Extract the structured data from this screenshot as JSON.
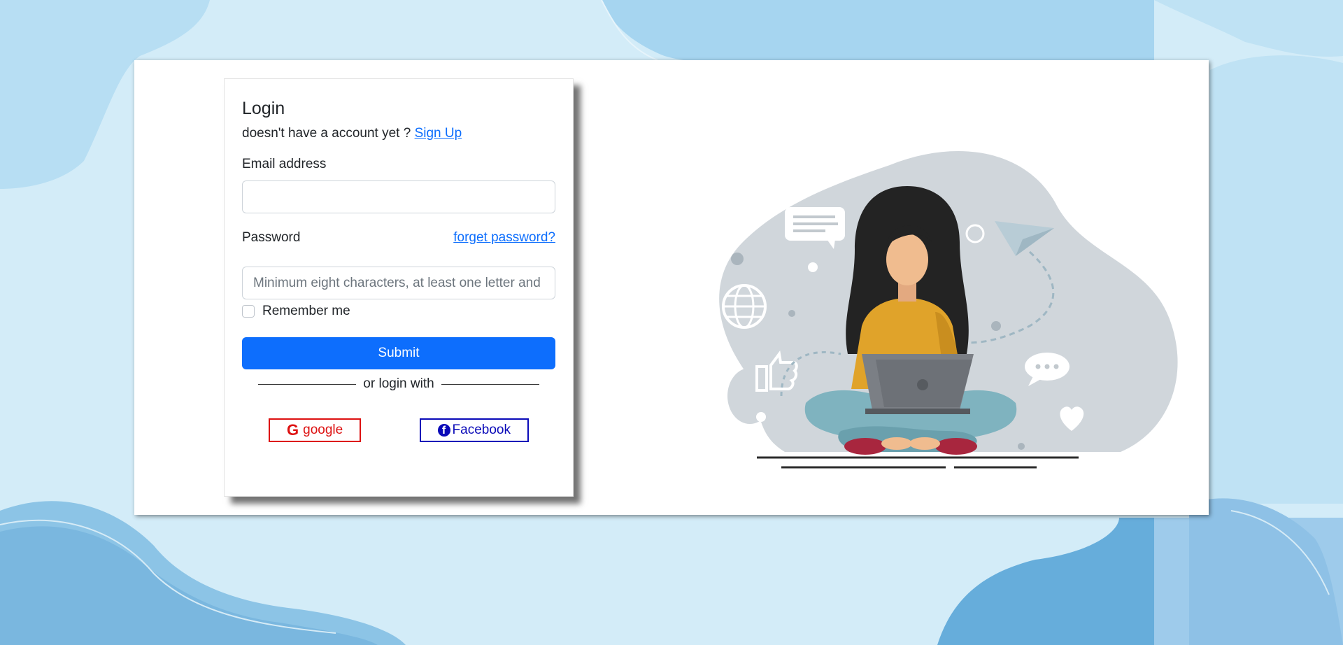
{
  "login": {
    "title": "Login",
    "signup_prompt": "doesn't have a account yet ?",
    "signup_link": "Sign Up",
    "email_label": "Email address",
    "email_value": "",
    "email_placeholder": "",
    "password_label": "Password",
    "forgot_link": "forget password?",
    "password_placeholder": "Minimum eight characters, at least one letter and one number",
    "remember_label": "Remember me",
    "remember_checked": false,
    "submit_label": "Submit",
    "divider_text": "or login with",
    "google_label": "google",
    "facebook_label": "Facebook"
  },
  "colors": {
    "primary": "#0d6efd",
    "google": "#dd1111",
    "facebook": "#0a0ab8",
    "background": "#d3ecf8"
  },
  "icons": {
    "google": "google-icon",
    "facebook": "facebook-icon"
  }
}
